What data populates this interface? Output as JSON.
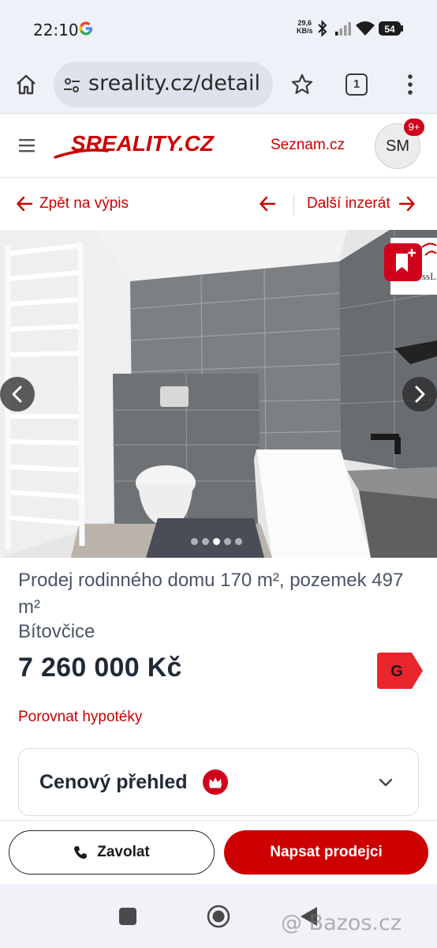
{
  "status_bar": {
    "time": "22:10",
    "net_speed_value": "29,6",
    "net_speed_unit": "KB/s",
    "battery": "54"
  },
  "browser": {
    "url": "sreality.cz/detail",
    "tab_count": "1"
  },
  "header": {
    "logo_text": "SREALITY.CZ",
    "seznam_link": "Seznam.cz",
    "avatar_initials": "SM",
    "notification_badge": "9+"
  },
  "nav": {
    "back_label": "Zpět na výpis",
    "next_label": "Další inzerát"
  },
  "gallery": {
    "dot_count": 5,
    "active_dot": 3,
    "agency_logo_text": "ssL"
  },
  "listing": {
    "title": "Prodej rodinného domu 170 m², pozemek 497 m²",
    "location": "Bítovčice",
    "price": "7 260 000 Kč",
    "energy_class": "G",
    "mortgage_link": "Porovnat hypotéky",
    "price_overview_label": "Cenový přehled"
  },
  "actions": {
    "call_label": "Zavolat",
    "write_label": "Napsat prodejci"
  },
  "watermark": "@ Bazos.cz",
  "colors": {
    "brand_red": "#cc0000",
    "chrome_bg": "#eef1f8",
    "badge_red": "#d0021b"
  }
}
